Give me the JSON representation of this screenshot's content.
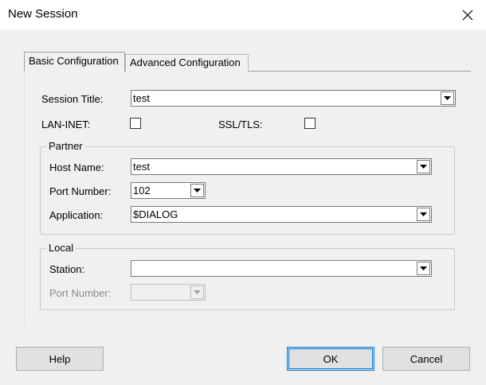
{
  "window": {
    "title": "New Session",
    "close_icon": "close-icon"
  },
  "tabs": [
    {
      "label": "Basic Configuration",
      "active": true
    },
    {
      "label": "Advanced Configuration",
      "active": false
    }
  ],
  "session": {
    "title_label": "Session Title:",
    "title_value": "test",
    "lan_inet_label": "LAN-INET:",
    "lan_inet_checked": false,
    "ssl_tls_label": "SSL/TLS:",
    "ssl_tls_checked": false
  },
  "partner": {
    "legend": "Partner",
    "host_name_label": "Host Name:",
    "host_name_value": "test",
    "port_number_label": "Port Number:",
    "port_number_value": "102",
    "application_label": "Application:",
    "application_value": "$DIALOG"
  },
  "local": {
    "legend": "Local",
    "station_label": "Station:",
    "station_value": "",
    "port_number_label": "Port Number:",
    "port_number_value": "",
    "port_number_enabled": false
  },
  "buttons": {
    "help": "Help",
    "ok": "OK",
    "cancel": "Cancel"
  },
  "colors": {
    "dialog_bg": "#f0f0f0",
    "titlebar_bg": "#ffffff",
    "default_button_border": "#0078d7"
  }
}
